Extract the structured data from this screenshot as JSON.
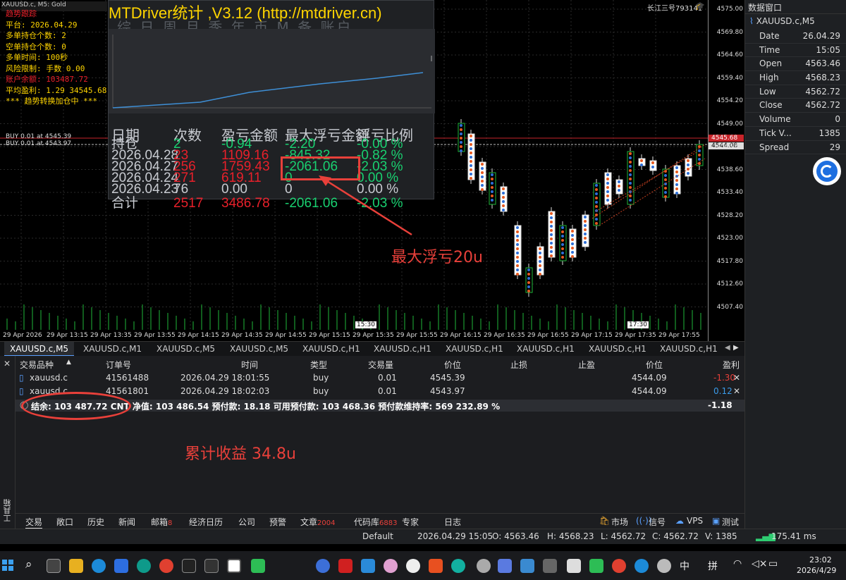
{
  "chart": {
    "symbol_tab": "XAUUSD.c, M5: Gold",
    "broker_label": "长江三号793141",
    "prices": [
      "4575.00",
      "4569.80",
      "4564.60",
      "4559.40",
      "4554.20",
      "4549.00",
      "4543.80",
      "4538.60",
      "4533.40",
      "4528.20",
      "4523.00",
      "4517.80",
      "4512.60",
      "4507.40"
    ],
    "price_tag_1": "4545.68",
    "price_tag_2": "4544.08",
    "times": [
      "29 Apr 2026",
      "29 Apr 13:15",
      "29 Apr 13:35",
      "29 Apr 13:55",
      "29 Apr 14:15",
      "29 Apr 14:35",
      "29 Apr 14:55",
      "29 Apr 15:15",
      "29 Apr 15:35",
      "29 Apr 15:55",
      "29 Apr 16:15",
      "29 Apr 16:35",
      "29 Apr 16:55",
      "29 Apr 17:15",
      "29 Apr 17:35",
      "29 Apr 17:55"
    ],
    "marker_1530": "15:30",
    "marker_1730": "17:30",
    "buy_label_1": "BUY 0.01 at 4545.39",
    "buy_label_2": "BUY 0.01 at 4543.97",
    "ea_lines": [
      "趋势跟踪",
      "平台: 2026.04.29",
      "多单持仓个数: 2",
      "空单持仓个数: 0",
      "多单时间: 100秒",
      "风险限制: 手数 0.00",
      "账户余额: 103487.72",
      "平均盈利: 1.29 34545.68",
      "*** 趋势转换加仓中 ***"
    ]
  },
  "stats": {
    "title": "MTDriver统计 ,V3.12 (http://mtdriver.cn)",
    "tabs": "综 日 周 月 季 年 币 M 备 账户",
    "headers": [
      "日期",
      "次数",
      "盈亏金额",
      "最大浮亏金额",
      "浮亏比例"
    ],
    "rows": [
      {
        "c1": "持仓",
        "c2": "2",
        "c3": "-0.94",
        "c4": "-2.20",
        "c5": "-0.00 %",
        "cls": [
          "c-w",
          "c-g",
          "c-g",
          "c-g",
          "c-g"
        ]
      },
      {
        "c1": "2026.04.28",
        "c2": "23",
        "c3": "1109.16",
        "c4": "-845.32",
        "c5": "-0.82 %",
        "cls": [
          "c-w",
          "c-r",
          "c-r",
          "c-g",
          "c-g"
        ]
      },
      {
        "c1": "2026.04.27",
        "c2": "256",
        "c3": "1759.43",
        "c4": "-2061.06",
        "c5": "-2.03 %",
        "cls": [
          "c-w",
          "c-r",
          "c-r",
          "c-g",
          "c-g"
        ]
      },
      {
        "c1": "2026.04.24",
        "c2": "271",
        "c3": "619.11",
        "c4": "0",
        "c5": "0.00 %",
        "cls": [
          "c-w",
          "c-r",
          "c-r",
          "c-g",
          "c-g"
        ]
      },
      {
        "c1": "2026.04.23",
        "c2": "76",
        "c3": "0.00",
        "c4": "0",
        "c5": "0.00 %",
        "cls": [
          "c-w",
          "c-w",
          "c-w",
          "c-w",
          "c-w"
        ]
      }
    ],
    "total": {
      "label": "合计",
      "count": "2517",
      "pnl": "3486.78",
      "maxdd": "-2061.06",
      "ratio": "-2.03 %"
    }
  },
  "annotations": {
    "max_dd": "最大浮亏20u",
    "cum_profit": "累计收益 34.8u"
  },
  "data_window": {
    "title": "数据窗口",
    "symbol": "XAUUSD.c,M5",
    "rows": [
      {
        "k": "Date",
        "v": "26.04.29"
      },
      {
        "k": "Time",
        "v": "15:05"
      },
      {
        "k": "Open",
        "v": "4563.46"
      },
      {
        "k": "High",
        "v": "4568.23"
      },
      {
        "k": "Low",
        "v": "4562.72"
      },
      {
        "k": "Close",
        "v": "4562.72"
      },
      {
        "k": "Volume",
        "v": "0"
      },
      {
        "k": "Tick V...",
        "v": "1385"
      },
      {
        "k": "Spread",
        "v": "29"
      }
    ]
  },
  "chart_tabs": [
    "XAUUSD.c,M5",
    "XAUUSD.c,M1",
    "XAUUSD.c,M5",
    "XAUUSD.c,M5",
    "XAUUSD.c,H1",
    "XAUUSD.c,H1",
    "XAUUSD.c,H1",
    "XAUUSD.c,H1",
    "XAUUSD.c,H1",
    "XAUUSD.c,H1"
  ],
  "terminal": {
    "headers": {
      "symbol": "交易品种",
      "order": "订单号",
      "time": "时间",
      "type": "类型",
      "volume": "交易量",
      "price": "价位",
      "sl": "止损",
      "tp": "止盈",
      "cur_price": "价位",
      "profit": "盈利"
    },
    "orders": [
      {
        "symbol": "xauusd.c",
        "order": "41561488",
        "time": "2026.04.29 18:01:55",
        "type": "buy",
        "volume": "0.01",
        "price": "4545.39",
        "cur_price": "4544.09",
        "profit": "-1.30"
      },
      {
        "symbol": "xauusd.c",
        "order": "41561801",
        "time": "2026.04.29 18:02:03",
        "type": "buy",
        "volume": "0.01",
        "price": "4543.97",
        "cur_price": "4544.09",
        "profit": "0.12"
      }
    ],
    "summary": "结余: 103 487.72 CNT  净值: 103 486.54  预付款: 18.18  可用预付款: 103 468.36  预付款维持率: 569 232.89 %",
    "summary_total": "-1.18",
    "side_label": "工具箱"
  },
  "bottom_tabs": {
    "items": [
      "交易",
      "敞口",
      "历史",
      "新闻",
      "邮箱",
      "经济日历",
      "公司",
      "预警",
      "文章",
      "代码库",
      "专家",
      "日志"
    ],
    "mail_count": "8",
    "article_count": "2004",
    "code_count": "6883",
    "market": "市场",
    "signals": "信号",
    "vps": "VPS",
    "tester": "测试"
  },
  "status": {
    "profile": "Default",
    "datetime": "2026.04.29 15:05",
    "open": "O: 4563.46",
    "high": "H: 4568.23",
    "low": "L: 4562.72",
    "close": "C: 4562.72",
    "volume": "V: 1385",
    "ping": "175.41 ms"
  },
  "taskbar": {
    "time": "23:02",
    "date": "2026/4/29",
    "ime1": "中",
    "ime2": "拼"
  }
}
